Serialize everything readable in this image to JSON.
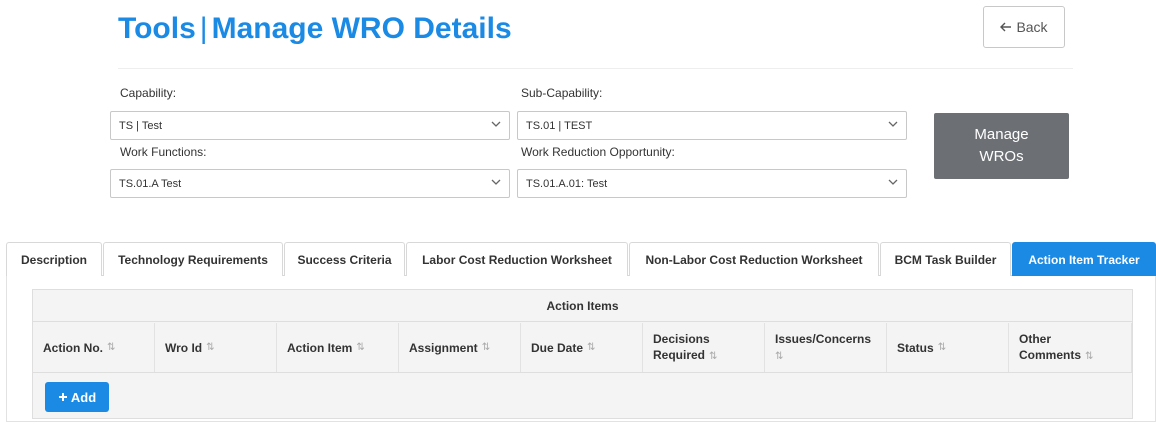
{
  "header": {
    "title_part1": "Tools",
    "title_separator": "|",
    "title_part2": "Manage WRO Details",
    "back_label": "Back",
    "back_icon": "arrow-left-icon"
  },
  "form": {
    "capability": {
      "label": "Capability:",
      "value": "TS | Test"
    },
    "sub_capability": {
      "label": "Sub-Capability:",
      "value": "TS.01 | TEST"
    },
    "work_functions": {
      "label": "Work Functions:",
      "value": "TS.01.A Test"
    },
    "wro": {
      "label": "Work Reduction Opportunity:",
      "value": "TS.01.A.01: Test"
    },
    "manage_button": {
      "line1": "Manage",
      "line2": "WROs"
    }
  },
  "tabs": [
    {
      "label": "Description",
      "active": false
    },
    {
      "label": "Technology Requirements",
      "active": false
    },
    {
      "label": "Success Criteria",
      "active": false
    },
    {
      "label": "Labor Cost Reduction Worksheet",
      "active": false
    },
    {
      "label": "Non-Labor Cost Reduction Worksheet",
      "active": false
    },
    {
      "label": "BCM Task Builder",
      "active": false
    },
    {
      "label": "Action Item Tracker",
      "active": true
    }
  ],
  "table": {
    "caption": "Action Items",
    "columns": [
      {
        "line1": "Action No.",
        "line2": ""
      },
      {
        "line1": "Wro Id",
        "line2": ""
      },
      {
        "line1": "Action Item",
        "line2": ""
      },
      {
        "line1": "Assignment",
        "line2": ""
      },
      {
        "line1": "Due Date",
        "line2": ""
      },
      {
        "line1": "Decisions",
        "line2": "Required"
      },
      {
        "line1": "Issues/Concerns",
        "line2": ""
      },
      {
        "line1": "Status",
        "line2": ""
      },
      {
        "line1": "Other",
        "line2": "Comments"
      }
    ],
    "sort_icon": "sort-icon",
    "sort_glyph": "⇅",
    "add_label": "Add",
    "add_icon": "plus-icon"
  },
  "colors": {
    "accent": "#1a8ae5",
    "manage_button": "#6c7075"
  }
}
